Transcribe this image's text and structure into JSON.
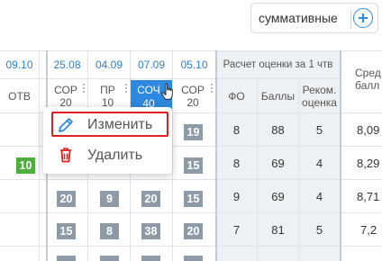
{
  "toolbar": {
    "summative_label": "суммативные",
    "add_icon": "plus-circle-icon"
  },
  "dates": [
    "09.10",
    "25.08",
    "04.09",
    "07.09",
    "05.10"
  ],
  "calc_header": "Расчет оценки за 1 чтв",
  "avg_header": [
    "Сред.",
    "балл"
  ],
  "columns": [
    {
      "label": "ОТВ",
      "weight": ""
    },
    {
      "label": "СОР",
      "weight": "20"
    },
    {
      "label": "ПР",
      "weight": "10"
    },
    {
      "label": "СОЧ",
      "weight": "40"
    },
    {
      "label": "СОР",
      "weight": "20"
    }
  ],
  "calc_cols": [
    "ФО",
    "Баллы",
    "Реком.|оценка"
  ],
  "rows": [
    {
      "otv": "",
      "sor1": "",
      "pr": "",
      "soch": "",
      "sor2": "19",
      "fo": "8",
      "balls": "88",
      "rec": "5",
      "avg": "8,09"
    },
    {
      "otv": "10",
      "sor1": "",
      "pr": "",
      "soch": "",
      "sor2": "15",
      "fo": "8",
      "balls": "69",
      "rec": "4",
      "avg": "8,29"
    },
    {
      "otv": "",
      "sor1": "20",
      "pr": "9",
      "soch": "20",
      "sor2": "15",
      "fo": "9",
      "balls": "69",
      "rec": "4",
      "avg": "8,71"
    },
    {
      "otv": "",
      "sor1": "15",
      "pr": "8",
      "soch": "38",
      "sor2": "20",
      "fo": "7",
      "balls": "81",
      "rec": "5",
      "avg": "7,2"
    }
  ],
  "context_menu": {
    "edit_label": "Изменить",
    "delete_label": "Удалить"
  },
  "colors": {
    "accent": "#2d8ae0",
    "highlight": "#e02020",
    "grade_bg": "#8e9aa6",
    "grade_green": "#4caf3c"
  }
}
